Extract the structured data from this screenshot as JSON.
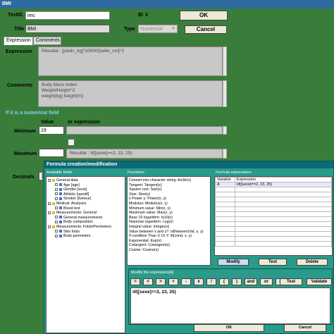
{
  "win": {
    "title": "BMI"
  },
  "header": {
    "textid_label": "TextID",
    "textid_value": "imc",
    "id_label": "ID",
    "id_value": "3",
    "title_label": "Title",
    "title_value": "BMI",
    "type_label": "Type",
    "type_value": "Numerical",
    "ok_label": "OK",
    "cancel_label": "Cancel"
  },
  "tabs": [
    {
      "label": "Expression"
    },
    {
      "label": "Comments"
    }
  ],
  "expression": {
    "label": "Expression",
    "text": "Résultat : [poids_kg]*10000/[taille_cm]^2"
  },
  "comments": {
    "label": "Comments",
    "lines": [
      "Body Mass Index:",
      "Weight/Height^2",
      "weight(kg) height(m)"
    ]
  },
  "numerical": {
    "section_label": "If it is a numerical field",
    "col_value": "Value",
    "col_expr": "or expression",
    "minimum_label": "Minimum",
    "minimum_value": "19",
    "maximum_label": "Maximum",
    "maximum_expr": "Résultat : iif([sexe]==2, 23, 25)",
    "decimals_label": "Decimals",
    "decimals_value": "1"
  },
  "dialog": {
    "title": "Formula creation/modification",
    "fields_title": "Available fields",
    "functions_title": "Functions",
    "expressions_title": "Formula expressions",
    "tree": [
      {
        "level": 0,
        "kind": "folder",
        "label": "General data"
      },
      {
        "level": 1,
        "kind": "item",
        "label": "Age [age]"
      },
      {
        "level": 1,
        "kind": "item",
        "label": "Gender [sexe]"
      },
      {
        "level": 1,
        "kind": "item",
        "label": "Athletic [sportif]"
      },
      {
        "level": 1,
        "kind": "item",
        "label": "Smoker [fumeur]"
      },
      {
        "level": 0,
        "kind": "folder",
        "label": "Medical: Analyses"
      },
      {
        "level": 1,
        "kind": "item",
        "label": "Blood test"
      },
      {
        "level": 0,
        "kind": "folder",
        "label": "Measurements: General"
      },
      {
        "level": 1,
        "kind": "item",
        "label": "General measurements"
      },
      {
        "level": 1,
        "kind": "item",
        "label": "Body composition"
      },
      {
        "level": 0,
        "kind": "folder",
        "label": "Measurements: Folds/Perimeters"
      },
      {
        "level": 1,
        "kind": "item",
        "label": "Skin folds"
      },
      {
        "level": 1,
        "kind": "item",
        "label": "Body perimeters"
      }
    ],
    "functions": [
      "Convert into character string: AsStr(x)",
      "Tangent: Tangent(x)",
      "Square root: Sqrt(x)",
      "Sine: Sine(x)",
      "x Power y: Power(x, y)",
      "Modulus: Modulus(x, y)",
      "Minimum value: Min(x, y)",
      "Maximum value: Max(x, y)",
      "Base 10 logarithm: lo10(x)",
      "Neperian logarithm: Log(x)",
      "Integral value: Integer(x)",
      "Value between x and y?: isBetween(Val, x, y)",
      "If condition Than X Or Y: iif(cond, x, y)",
      "Exponential: Exp(x)",
      "Cotangent: Cotangent(x)",
      "Cosine: Cosine(x)"
    ],
    "expr_cols": [
      "Variable",
      "Expression"
    ],
    "expr_rows": [
      {
        "var": "A",
        "expr": "iif([sexe]==2, 23, 25)"
      }
    ],
    "modify_label": "Modify",
    "test_label": "Test",
    "delete_label": "Delete",
    "modify_expr_title": "Modify the expression[A]",
    "ops": [
      "=",
      "<",
      ">",
      "+",
      "-",
      "x",
      "/",
      "(",
      ")",
      "and",
      "or",
      "no"
    ],
    "test2_label": "Test",
    "validate_label": "Validate",
    "expr_value": "iif([sexe]==2, 23, 25)",
    "ok_label": "OK",
    "cancel_label": "Cancel"
  }
}
